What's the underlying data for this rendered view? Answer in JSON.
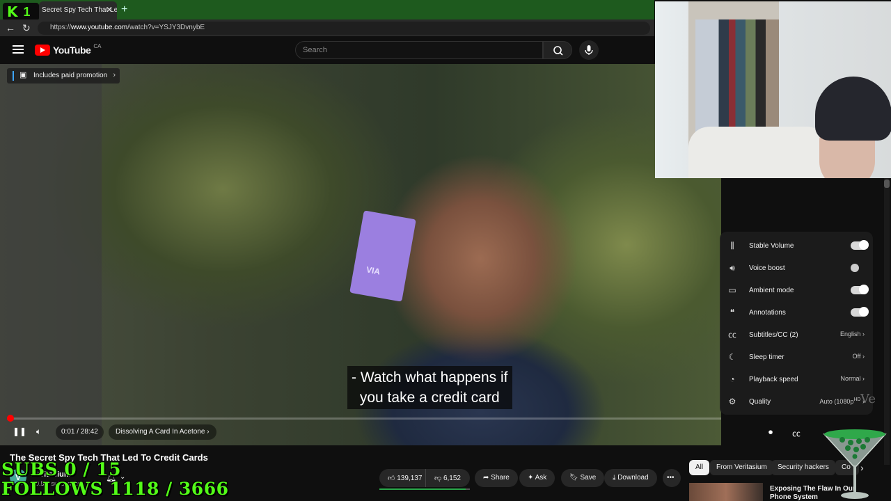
{
  "browser": {
    "overlay_badge_number": "1",
    "tab_title": "Secret Spy Tech That Led",
    "url_prefix": "https://",
    "url_domain": "www.youtube.com",
    "url_path": "/watch?v=YSJY3DvnybE"
  },
  "youtube": {
    "logo_text": "YouTube",
    "country": "CA",
    "search_placeholder": "Search"
  },
  "video": {
    "promo_label": "Includes paid promotion",
    "caption_line1": "- Watch what happens if",
    "caption_line2": "you take a credit card",
    "card_text": "VIA",
    "time": "0:01 / 28:42",
    "chapter": "Dissolving A Card In Acetone",
    "progress_fraction": 0.0006
  },
  "settings": {
    "items": [
      {
        "label": "Stable Volume",
        "icon": "stable-volume-icon",
        "toggle": "on"
      },
      {
        "label": "Voice boost",
        "icon": "voice-boost-icon",
        "toggle": "off"
      },
      {
        "label": "Ambient mode",
        "icon": "ambient-mode-icon",
        "toggle": "on"
      },
      {
        "label": "Annotations",
        "icon": "annotations-icon",
        "toggle": "on"
      },
      {
        "label": "Subtitles/CC (2)",
        "icon": "subtitles-icon",
        "value": "English"
      },
      {
        "label": "Sleep timer",
        "icon": "sleep-timer-icon",
        "value": "Off"
      },
      {
        "label": "Playback speed",
        "icon": "playback-speed-icon",
        "value": "Normal"
      },
      {
        "label": "Quality",
        "icon": "quality-icon",
        "value": "Auto (1080p",
        "badge": "HD"
      }
    ]
  },
  "below": {
    "title": "The Secret Spy Tech That Led To Credit Cards",
    "channel_name": "Veritasium",
    "channel_avatar_letter": "V",
    "subscribers": "20.5M subscribers",
    "likes": "139,137",
    "dislikes": "6,152",
    "share": "Share",
    "ask": "Ask",
    "save": "Save",
    "download": "Download",
    "chips": [
      "All",
      "From Veritasium",
      "Security hackers",
      "Co"
    ],
    "rec_title": "Exposing The Flaw In Our Phone System"
  },
  "overlay": {
    "subs": "SUBS 0 / 15",
    "follows": "FOLLOWS 1118 / 3666",
    "watermark": "Ve"
  },
  "colors": {
    "kick_green": "#53fc18",
    "yt_red": "#ff0000",
    "like_green": "#2aa84a"
  }
}
